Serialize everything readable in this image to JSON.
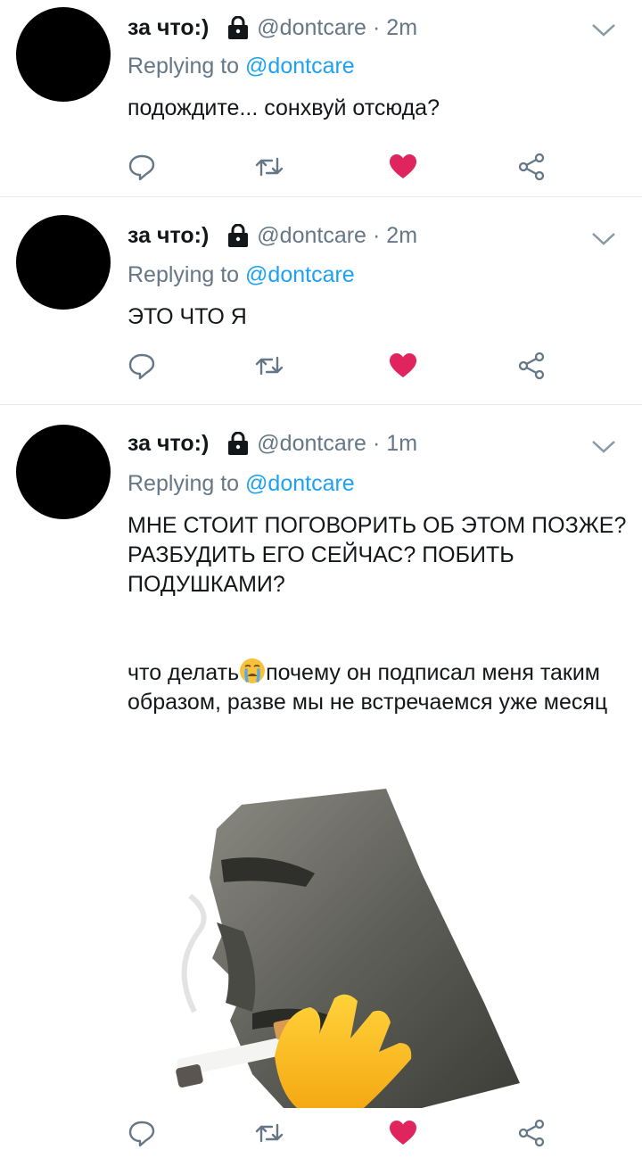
{
  "tweets": [
    {
      "name": "за что:)",
      "handle": "@dontcare",
      "separator": "·",
      "time": "2m",
      "reply_prefix": "Replying to",
      "reply_to": "@dontcare",
      "text": "подождите... сонхвуй отсюда?",
      "liked": true
    },
    {
      "name": "за что:)",
      "handle": "@dontcare",
      "separator": "·",
      "time": "2m",
      "reply_prefix": "Replying to",
      "reply_to": "@dontcare",
      "text": "ЭТО ЧТО Я",
      "liked": true
    },
    {
      "name": "за что:)",
      "handle": "@dontcare",
      "separator": "·",
      "time": "1m",
      "reply_prefix": "Replying to",
      "reply_to": "@dontcare",
      "text_p1": "МНЕ СТОИТ ПОГОВОРИТЬ ОБ ЭТОМ ПОЗЖЕ? РАЗБУДИТЬ ЕГО СЕЙЧАС? ПОБИТЬ ПОДУШКАМИ?",
      "text_p2_before": "что делать",
      "text_p2_after": "почему он подписал меня таким образом, разве мы не встречаемся уже месяц",
      "inline_emoji": "crying-face-icon",
      "media": "moai-smoking-image",
      "liked": true
    }
  ],
  "icons": {
    "reply": "reply-icon",
    "retweet": "retweet-icon",
    "like": "heart-icon",
    "share": "share-icon",
    "protected": "lock-icon",
    "menu": "chevron-down-icon"
  },
  "colors": {
    "text": "#14171a",
    "secondary": "#657786",
    "link": "#1da1f2",
    "like": "#e0245e",
    "divider": "#e6ecf0"
  }
}
